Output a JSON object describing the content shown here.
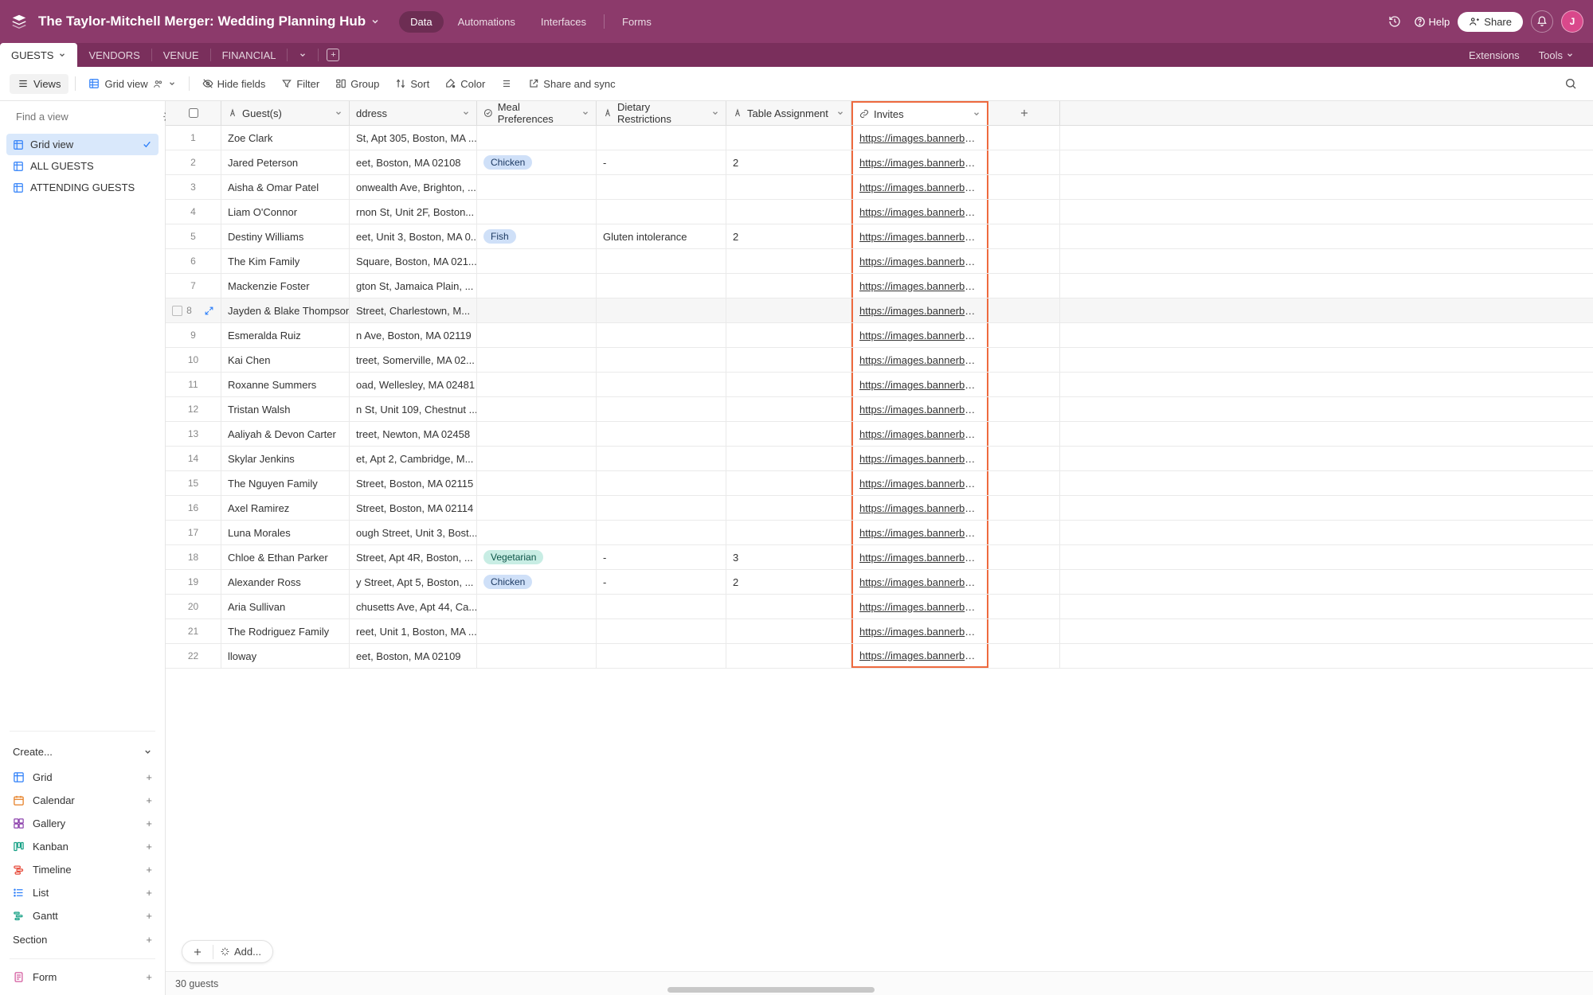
{
  "header": {
    "title": "The Taylor-Mitchell Merger: Wedding Planning Hub",
    "nav": {
      "data": "Data",
      "automations": "Automations",
      "interfaces": "Interfaces",
      "forms": "Forms"
    },
    "help": "Help",
    "share": "Share",
    "avatar_initial": "J"
  },
  "tables": {
    "items": [
      "GUESTS",
      "VENDORS",
      "VENUE",
      "FINANCIAL"
    ],
    "right": {
      "extensions": "Extensions",
      "tools": "Tools"
    }
  },
  "toolbar": {
    "views": "Views",
    "grid_view": "Grid view",
    "hide_fields": "Hide fields",
    "filter": "Filter",
    "group": "Group",
    "sort": "Sort",
    "color": "Color",
    "share_sync": "Share and sync"
  },
  "sidebar": {
    "search_placeholder": "Find a view",
    "views": [
      {
        "label": "Grid view",
        "active": true
      },
      {
        "label": "ALL GUESTS",
        "active": false
      },
      {
        "label": "ATTENDING GUESTS",
        "active": false
      }
    ],
    "create_header": "Create...",
    "create": {
      "grid": "Grid",
      "calendar": "Calendar",
      "gallery": "Gallery",
      "kanban": "Kanban",
      "timeline": "Timeline",
      "list": "List",
      "gantt": "Gantt"
    },
    "section": "Section",
    "form": "Form"
  },
  "grid": {
    "headers": {
      "guest": "Guest(s)",
      "address": "ddress",
      "meal": "Meal Preferences",
      "diet": "Dietary Restrictions",
      "table": "Table Assignment",
      "invites": "Invites"
    },
    "invite_link_text": "https://images.bannerbea...",
    "rows": [
      {
        "n": "1",
        "guest": "Zoe Clark",
        "address": "St, Apt 305, Boston, MA ...",
        "meal": "",
        "diet": "",
        "table": ""
      },
      {
        "n": "2",
        "guest": "Jared Peterson",
        "address": "eet, Boston, MA 02108",
        "meal": "Chicken",
        "meal_cls": "pill-chicken",
        "diet": "-",
        "table": "2"
      },
      {
        "n": "3",
        "guest": "Aisha & Omar Patel",
        "address": "onwealth Ave, Brighton, ...",
        "meal": "",
        "diet": "",
        "table": ""
      },
      {
        "n": "4",
        "guest": "Liam O'Connor",
        "address": "rnon St, Unit 2F, Boston...",
        "meal": "",
        "diet": "",
        "table": ""
      },
      {
        "n": "5",
        "guest": "Destiny Williams",
        "address": "eet, Unit 3, Boston, MA 0...",
        "meal": "Fish",
        "meal_cls": "pill-fish",
        "diet": "Gluten intolerance",
        "table": "2"
      },
      {
        "n": "6",
        "guest": "The Kim Family",
        "address": "Square, Boston, MA 021...",
        "meal": "",
        "diet": "",
        "table": ""
      },
      {
        "n": "7",
        "guest": "Mackenzie Foster",
        "address": "gton St, Jamaica Plain, ...",
        "meal": "",
        "diet": "",
        "table": ""
      },
      {
        "n": "8",
        "guest": "Jayden & Blake Thompson",
        "address": "Street, Charlestown, M...",
        "meal": "",
        "diet": "",
        "table": "",
        "hover": true
      },
      {
        "n": "9",
        "guest": "Esmeralda Ruiz",
        "address": "n Ave, Boston, MA 02119",
        "meal": "",
        "diet": "",
        "table": ""
      },
      {
        "n": "10",
        "guest": "Kai Chen",
        "address": "treet, Somerville, MA 02...",
        "meal": "",
        "diet": "",
        "table": ""
      },
      {
        "n": "11",
        "guest": "Roxanne Summers",
        "address": "oad, Wellesley, MA 02481",
        "meal": "",
        "diet": "",
        "table": ""
      },
      {
        "n": "12",
        "guest": "Tristan Walsh",
        "address": "n St, Unit 109, Chestnut ...",
        "meal": "",
        "diet": "",
        "table": ""
      },
      {
        "n": "13",
        "guest": "Aaliyah & Devon Carter",
        "address": "treet, Newton, MA 02458",
        "meal": "",
        "diet": "",
        "table": ""
      },
      {
        "n": "14",
        "guest": "Skylar Jenkins",
        "address": "et, Apt 2, Cambridge, M...",
        "meal": "",
        "diet": "",
        "table": ""
      },
      {
        "n": "15",
        "guest": "The Nguyen Family",
        "address": "Street, Boston, MA 02115",
        "meal": "",
        "diet": "",
        "table": ""
      },
      {
        "n": "16",
        "guest": "Axel Ramirez",
        "address": "Street, Boston, MA 02114",
        "meal": "",
        "diet": "",
        "table": ""
      },
      {
        "n": "17",
        "guest": "Luna Morales",
        "address": "ough Street, Unit 3, Bost...",
        "meal": "",
        "diet": "",
        "table": ""
      },
      {
        "n": "18",
        "guest": "Chloe & Ethan Parker",
        "address": "Street, Apt 4R, Boston, ...",
        "meal": "Vegetarian",
        "meal_cls": "pill-veg",
        "diet": "-",
        "table": "3"
      },
      {
        "n": "19",
        "guest": "Alexander Ross",
        "address": "y Street, Apt 5, Boston, ...",
        "meal": "Chicken",
        "meal_cls": "pill-chicken",
        "diet": "-",
        "table": "2"
      },
      {
        "n": "20",
        "guest": "Aria Sullivan",
        "address": "chusetts Ave, Apt 44, Ca...",
        "meal": "",
        "diet": "",
        "table": ""
      },
      {
        "n": "21",
        "guest": "The Rodriguez Family",
        "address": "reet, Unit 1, Boston, MA ...",
        "meal": "",
        "diet": "",
        "table": ""
      },
      {
        "n": "22",
        "guest": "lloway",
        "address": "eet, Boston, MA 02109",
        "meal": "",
        "diet": "",
        "table": ""
      }
    ],
    "footer_count": "30 guests",
    "add_button": "Add..."
  }
}
